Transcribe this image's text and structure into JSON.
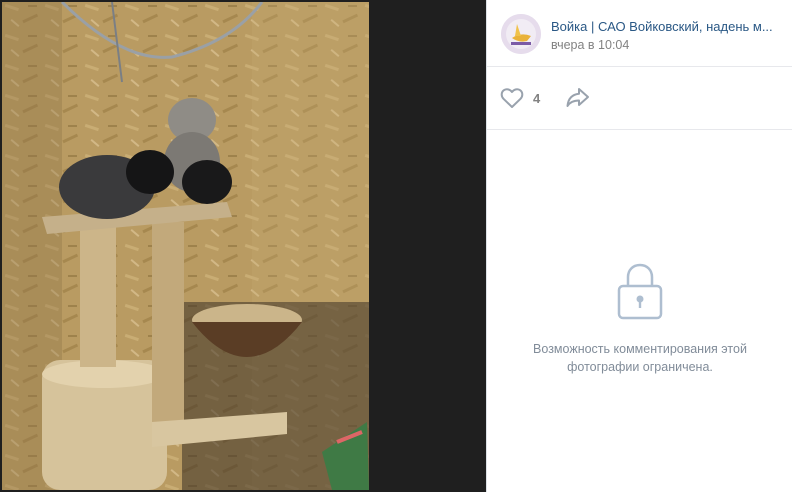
{
  "author": {
    "name": "Войка | САО Войковский, надень м...",
    "date": "вчера в 10:04",
    "avatar_icon": "avatar-logo-icon"
  },
  "actions": {
    "like_count": "4",
    "like_icon": "heart-icon",
    "share_icon": "share-arrow-icon"
  },
  "comments": {
    "lock_icon": "lock-icon",
    "message": "Возможность комментирования этой фотографии ограничена."
  },
  "colors": {
    "link": "#2a5885",
    "muted": "#828282",
    "icon": "#99a2ad",
    "lock": "#aebed0"
  }
}
